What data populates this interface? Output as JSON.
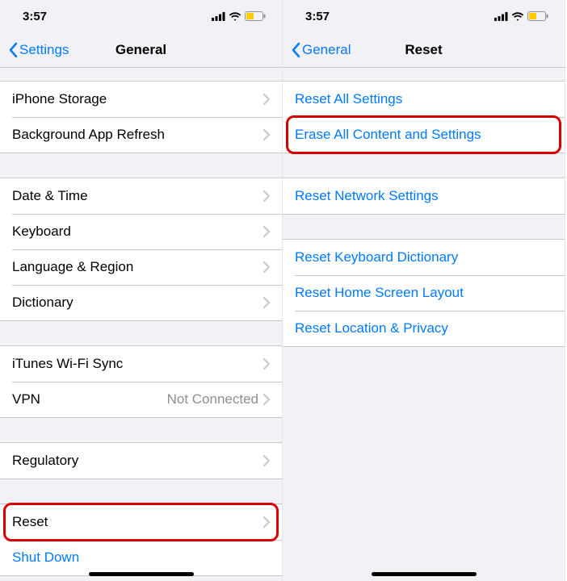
{
  "left": {
    "time": "3:57",
    "back_label": "Settings",
    "title": "General",
    "groups": [
      [
        {
          "label": "iPhone Storage",
          "chevron": true
        },
        {
          "label": "Background App Refresh",
          "chevron": true
        }
      ],
      [
        {
          "label": "Date & Time",
          "chevron": true
        },
        {
          "label": "Keyboard",
          "chevron": true
        },
        {
          "label": "Language & Region",
          "chevron": true
        },
        {
          "label": "Dictionary",
          "chevron": true
        }
      ],
      [
        {
          "label": "iTunes Wi-Fi Sync",
          "chevron": true
        },
        {
          "label": "VPN",
          "value": "Not Connected",
          "chevron": true
        }
      ],
      [
        {
          "label": "Regulatory",
          "chevron": true
        }
      ],
      [
        {
          "label": "Reset",
          "chevron": true,
          "highlight": true
        },
        {
          "label": "Shut Down",
          "link": true
        }
      ]
    ]
  },
  "right": {
    "time": "3:57",
    "back_label": "General",
    "title": "Reset",
    "groups": [
      [
        {
          "label": "Reset All Settings",
          "link": true
        },
        {
          "label": "Erase All Content and Settings",
          "link": true,
          "highlight": true
        }
      ],
      [
        {
          "label": "Reset Network Settings",
          "link": true
        }
      ],
      [
        {
          "label": "Reset Keyboard Dictionary",
          "link": true
        },
        {
          "label": "Reset Home Screen Layout",
          "link": true
        },
        {
          "label": "Reset Location & Privacy",
          "link": true
        }
      ]
    ]
  }
}
